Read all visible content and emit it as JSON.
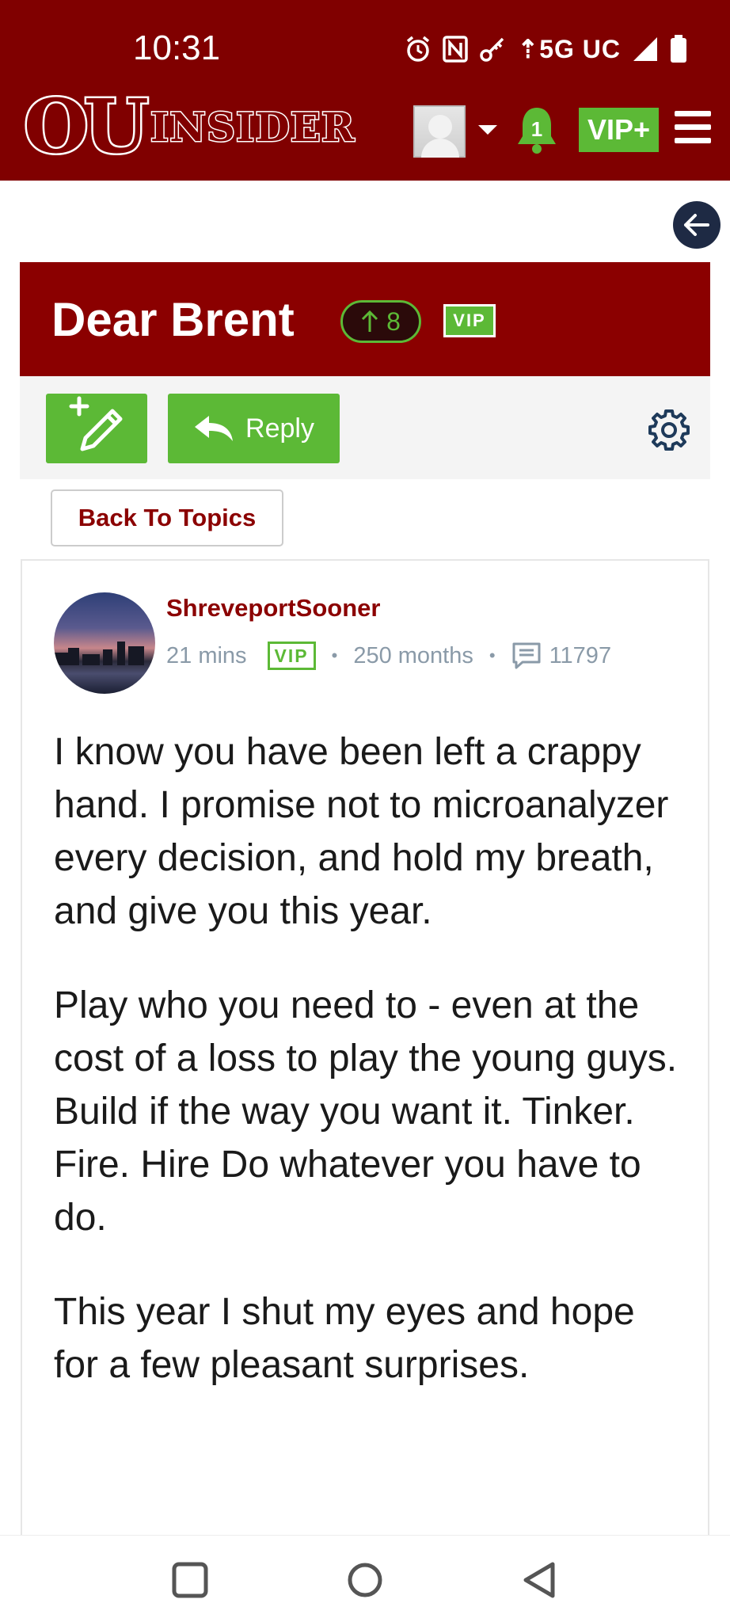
{
  "status_bar": {
    "time": "10:31",
    "network": "5G UC",
    "icons": [
      "alarm-icon",
      "nfc-icon",
      "vpn-key-icon",
      "signal-icon",
      "battery-icon"
    ]
  },
  "header": {
    "logo_ou": "OU",
    "logo_insider": "INSIDER",
    "notification_count": "1",
    "vip_plus_label": "VIP+",
    "background_color": "#800000",
    "accent_color": "#5cb936"
  },
  "thread": {
    "title": "Dear Brent",
    "upvotes": "8",
    "vip_badge": "VIP",
    "reply_label": "Reply",
    "back_to_topics_label": "Back To Topics"
  },
  "post": {
    "author": "ShreveportSooner",
    "time_ago": "21 mins",
    "vip_badge": "VIP",
    "membership": "250 months",
    "post_count": "11797",
    "paragraphs": [
      "I know you have been left a crappy hand. I promise not to microanalyzer every decision, and hold my breath, and give you this year.",
      "Play who you need to - even at the cost of a loss to play the young guys. Build if the way you want it. Tinker. Fire. Hire Do whatever you have to do.",
      "This year I shut my eyes and hope for a few pleasant surprises."
    ]
  },
  "nav_bar": {
    "buttons": [
      "recents-icon",
      "home-icon",
      "back-icon"
    ]
  }
}
